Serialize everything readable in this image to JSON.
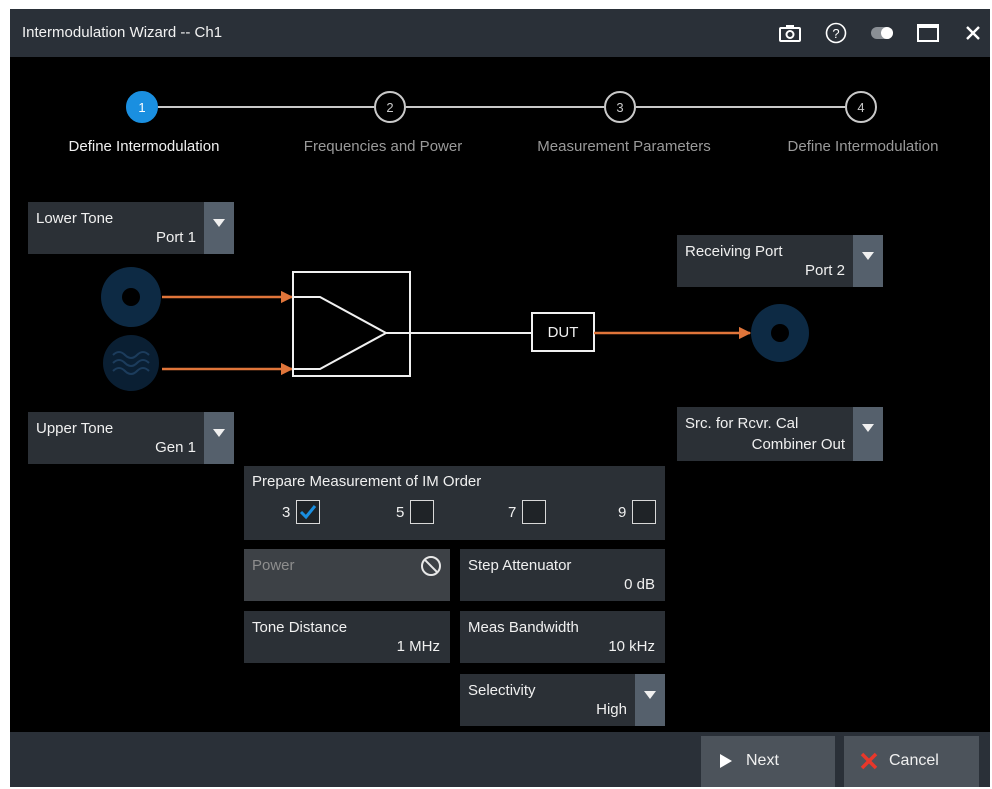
{
  "window": {
    "title": "Intermodulation Wizard -- Ch1"
  },
  "titlebar_icons": [
    "camera-icon",
    "help-icon",
    "toggle-icon",
    "maximize-icon",
    "close-icon"
  ],
  "steps": [
    {
      "number": "1",
      "label": "Define Intermodulation",
      "active": true
    },
    {
      "number": "2",
      "label": "Frequencies and Power",
      "active": false
    },
    {
      "number": "3",
      "label": "Measurement Parameters",
      "active": false
    },
    {
      "number": "4",
      "label": "Define Intermodulation",
      "active": false
    }
  ],
  "lower_tone": {
    "label": "Lower Tone",
    "value": "Port 1"
  },
  "upper_tone": {
    "label": "Upper Tone",
    "value": "Gen 1"
  },
  "receiving_port": {
    "label": "Receiving Port",
    "value": "Port 2"
  },
  "src_rcvr_cal": {
    "label": "Src. for Rcvr. Cal",
    "value": "Combiner Out"
  },
  "diagram": {
    "dut_label": "DUT"
  },
  "im_order": {
    "label": "Prepare Measurement of IM Order",
    "orders": [
      {
        "value": "3",
        "checked": true
      },
      {
        "value": "5",
        "checked": false
      },
      {
        "value": "7",
        "checked": false
      },
      {
        "value": "9",
        "checked": false
      }
    ]
  },
  "power": {
    "label": "Power",
    "disabled": true
  },
  "step_attenuator": {
    "label": "Step Attenuator",
    "value": "0 dB"
  },
  "tone_distance": {
    "label": "Tone Distance",
    "value": "1 MHz"
  },
  "meas_bandwidth": {
    "label": "Meas Bandwidth",
    "value": "10 kHz"
  },
  "selectivity": {
    "label": "Selectivity",
    "value": "High"
  },
  "buttons": {
    "next": "Next",
    "cancel": "Cancel"
  },
  "colors": {
    "accent": "#1a8fe0",
    "arrow": "#e0753a",
    "panel": "#2b3036",
    "port": "#0d2a44",
    "cancel_x": "#e8372a"
  }
}
